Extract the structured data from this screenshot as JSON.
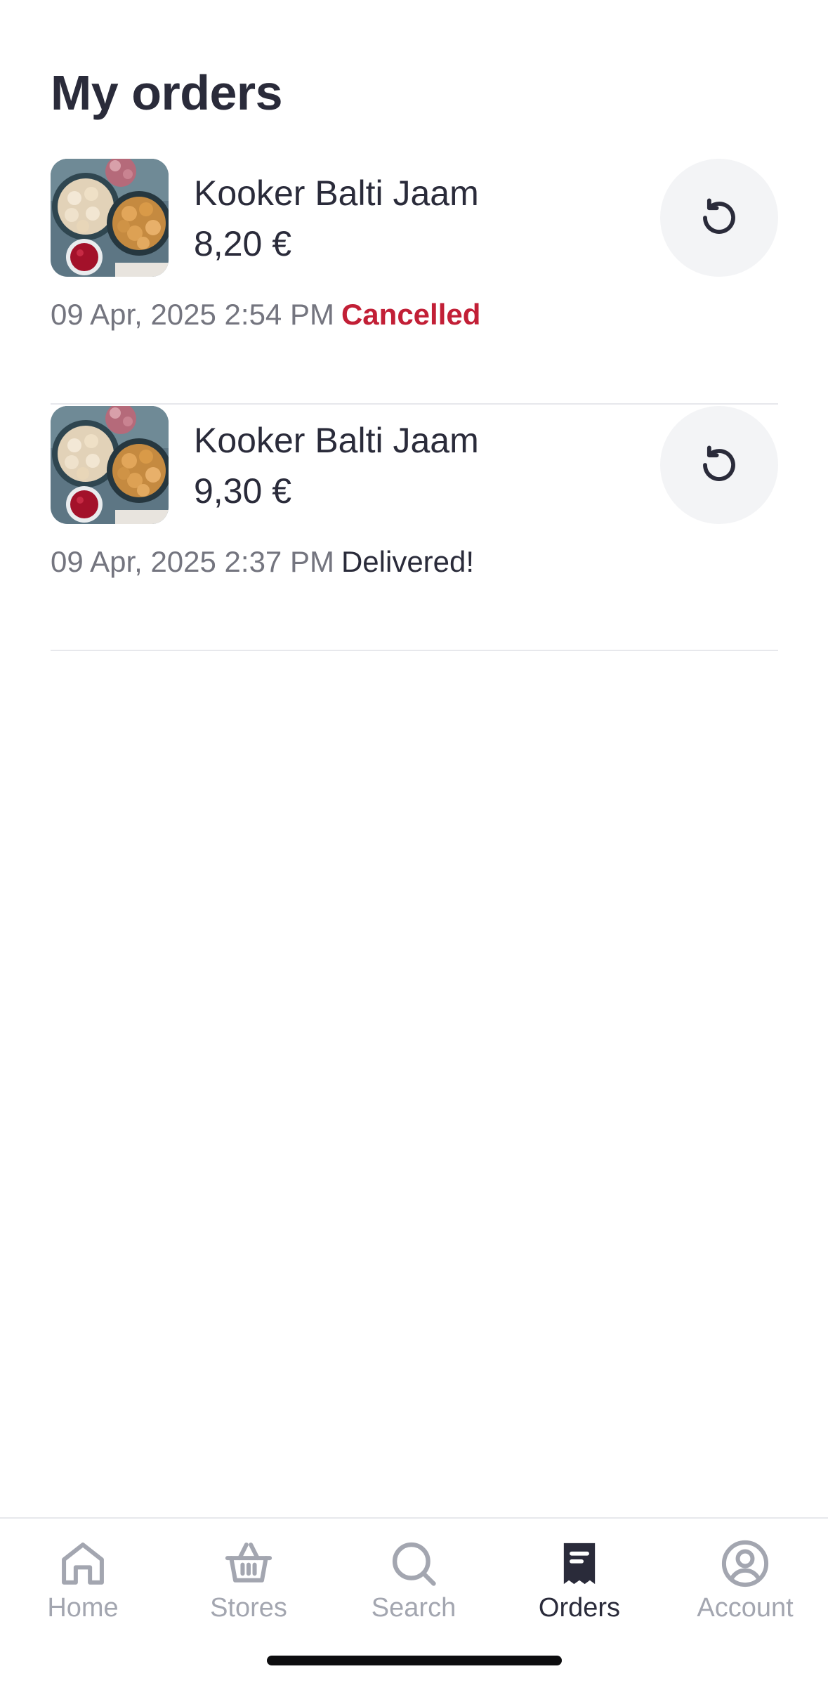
{
  "header": {
    "title": "My orders"
  },
  "orders": [
    {
      "store": "Kooker Balti Jaam",
      "price": "8,20 €",
      "date": "09 Apr, 2025 2:54 PM",
      "status": "Cancelled",
      "status_color": "#c21f36"
    },
    {
      "store": "Kooker Balti Jaam",
      "price": "9,30 €",
      "date": "09 Apr, 2025 2:37 PM",
      "status": "Delivered!",
      "status_color": "#2a2b3a"
    }
  ],
  "tab_bar": {
    "tabs": [
      {
        "label": "Home",
        "icon": "home-icon",
        "active": false
      },
      {
        "label": "Stores",
        "icon": "basket-icon",
        "active": false
      },
      {
        "label": "Search",
        "icon": "search-icon",
        "active": false
      },
      {
        "label": "Orders",
        "icon": "receipt-icon",
        "active": true
      },
      {
        "label": "Account",
        "icon": "account-icon",
        "active": false
      }
    ]
  },
  "colors": {
    "text_primary": "#2a2b3a",
    "text_secondary": "#74757f",
    "tab_inactive": "#a3a6b0",
    "cancelled": "#c21f36",
    "button_bg": "#f3f4f6"
  }
}
